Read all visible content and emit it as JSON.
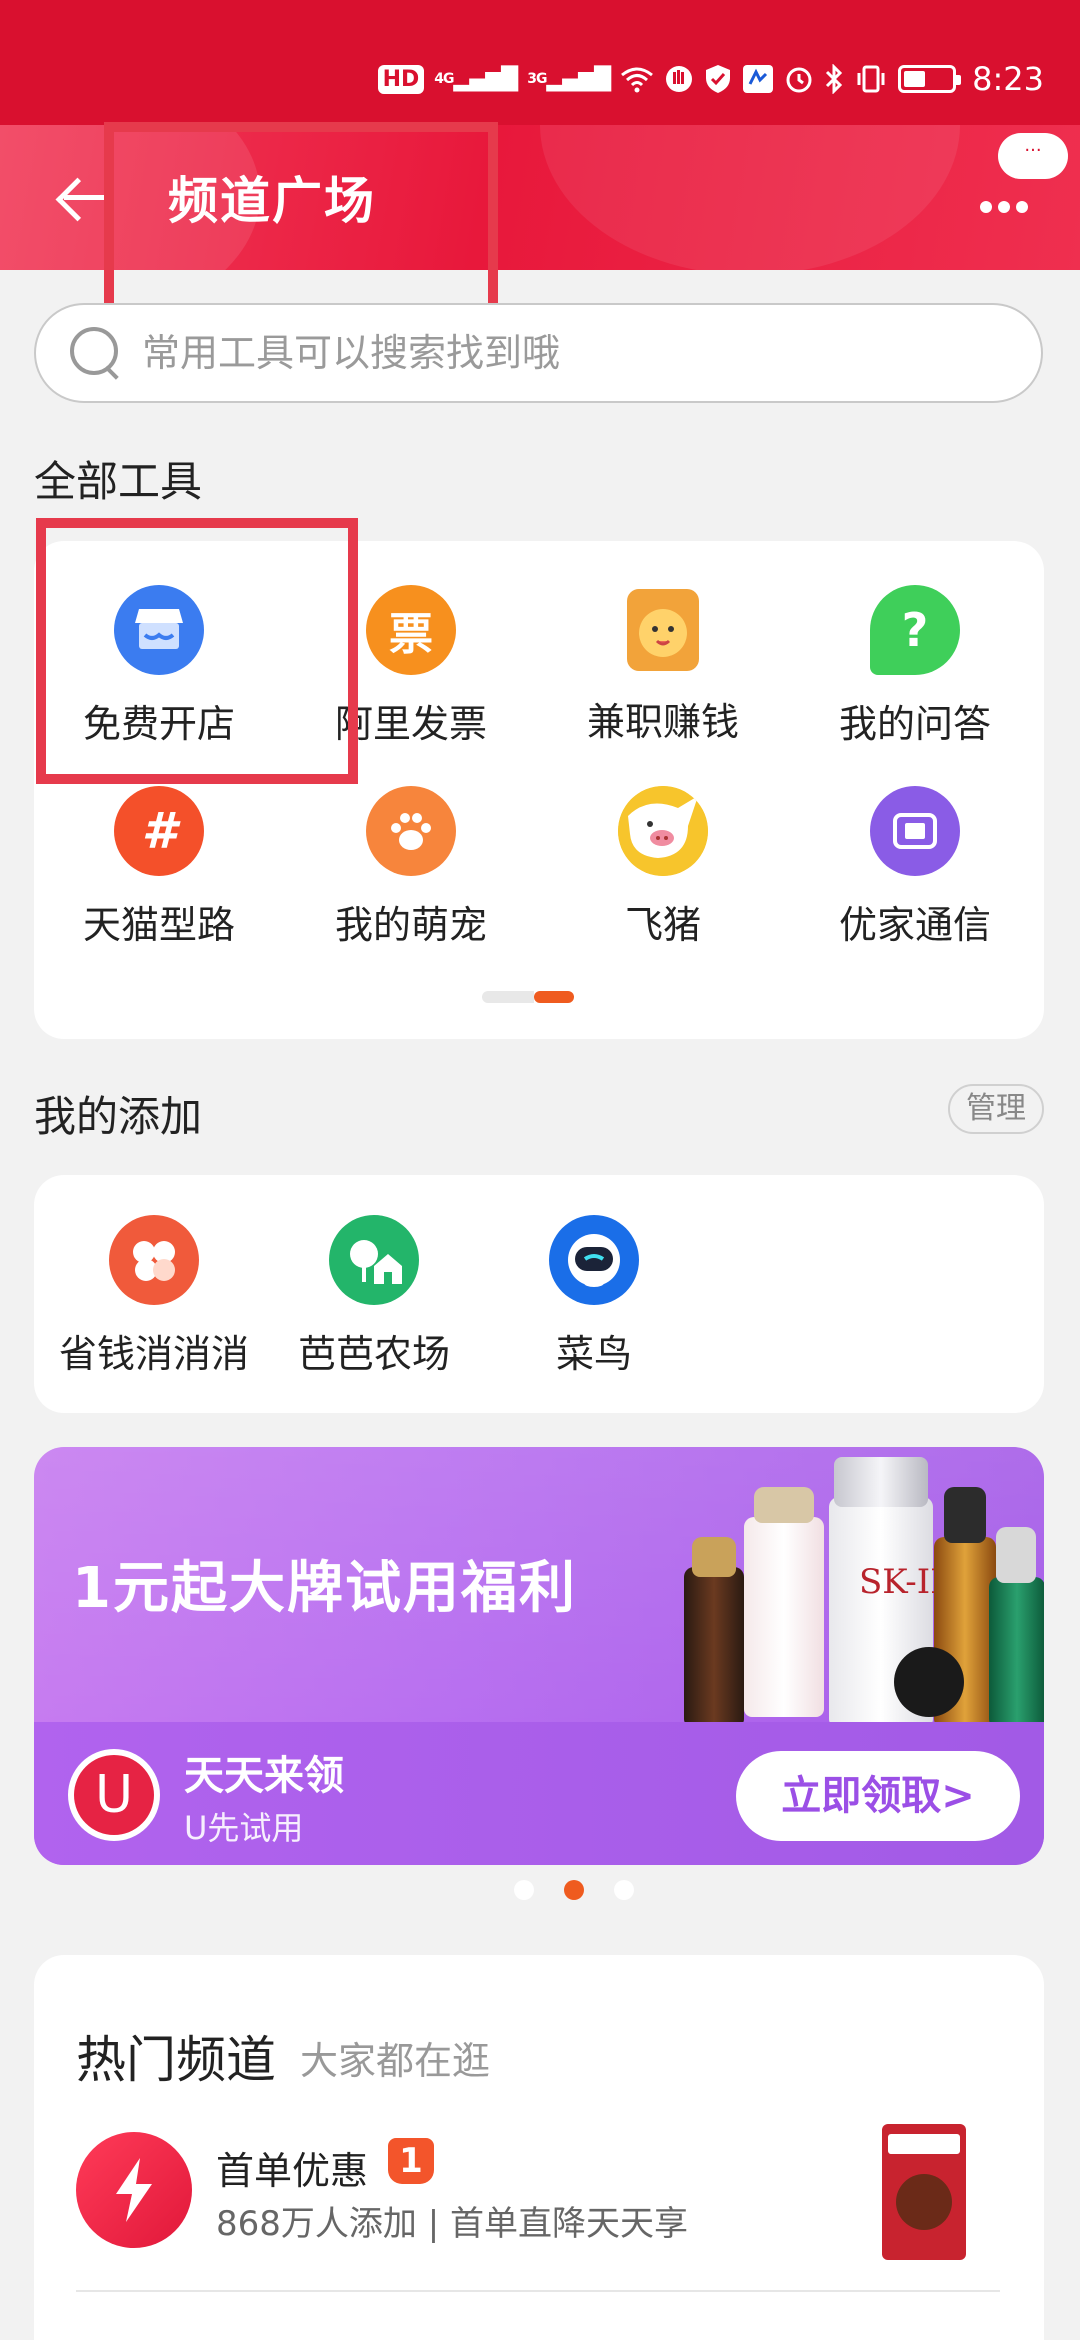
{
  "status_bar": {
    "hd": "HD",
    "signal1": "4G",
    "signal2": "3G",
    "time": "8:23",
    "battery_level": 0.45
  },
  "header": {
    "title": "频道广场",
    "more_label": "···"
  },
  "search": {
    "placeholder": "常用工具可以搜索找到哦"
  },
  "all_tools": {
    "title": "全部工具",
    "items": [
      {
        "label": "免费开店",
        "icon": "shop-icon",
        "color": "#3b7cf0"
      },
      {
        "label": "阿里发票",
        "icon": "invoice-icon",
        "color": "#f7901e",
        "glyph": "票"
      },
      {
        "label": "兼职赚钱",
        "icon": "lion-icon",
        "color": "#f2b338"
      },
      {
        "label": "我的问答",
        "icon": "question-icon",
        "color": "#3fcf5a",
        "glyph": "?"
      },
      {
        "label": "天猫型路",
        "icon": "hashtag-icon",
        "color": "#f4502a",
        "glyph": "#"
      },
      {
        "label": "我的萌宠",
        "icon": "paw-icon",
        "color": "#f7853c"
      },
      {
        "label": "飞猪",
        "icon": "pig-icon",
        "color": "#f7c52c"
      },
      {
        "label": "优家通信",
        "icon": "phone-card-icon",
        "color": "#8a5ce6"
      }
    ],
    "pager_active_index": 1
  },
  "my_added": {
    "title": "我的添加",
    "manage_label": "管理",
    "items": [
      {
        "label": "省钱消消消",
        "icon": "fruit-icon",
        "color": "#f05a3b"
      },
      {
        "label": "芭芭农场",
        "icon": "farm-icon",
        "color": "#23b56a"
      },
      {
        "label": "菜鸟",
        "icon": "cainiao-icon",
        "color": "#1a6ee8"
      }
    ]
  },
  "banner": {
    "title": "1元起大牌试用福利",
    "logo_letter": "U",
    "subtitle": "天天来领",
    "caption": "U先试用",
    "cta": "立即领取>",
    "active_dot": 1
  },
  "hot_channels": {
    "title": "热门频道",
    "subtitle": "大家都在逛",
    "items": [
      {
        "name": "首单优惠",
        "badge": "1",
        "desc": "868万人添加 | 首单直降天天享",
        "icon": "lightning-icon"
      }
    ]
  }
}
